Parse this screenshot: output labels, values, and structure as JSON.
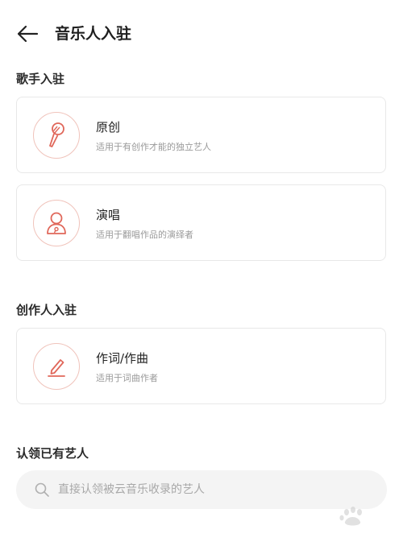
{
  "header": {
    "title": "音乐人入驻",
    "back_icon": "arrow-left-icon"
  },
  "sections": [
    {
      "title": "歌手入驻",
      "cards": [
        {
          "title": "原创",
          "desc": "适用于有创作才能的独立艺人",
          "icon": "microphone-icon"
        },
        {
          "title": "演唱",
          "desc": "适用于翻唱作品的演绎者",
          "icon": "singer-person-icon"
        }
      ]
    },
    {
      "title": "创作人入驻",
      "cards": [
        {
          "title": "作词/作曲",
          "desc": "适用于词曲作者",
          "icon": "pen-write-icon"
        }
      ]
    },
    {
      "title": "认领已有艺人"
    }
  ],
  "search": {
    "placeholder": "直接认领被云音乐收录的艺人",
    "icon": "search-icon"
  },
  "colors": {
    "accent": "#e0675a",
    "icon_ring": "#f0c3bb",
    "card_border": "#e8e8e8",
    "search_bg": "#f4f4f4",
    "desc_text": "#9a9a9a"
  }
}
